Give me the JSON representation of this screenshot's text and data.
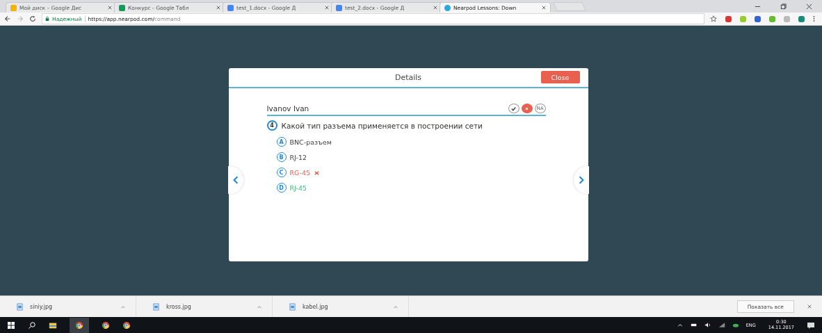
{
  "tabs": [
    {
      "title": "Мой диск – Google Дис",
      "selected": false
    },
    {
      "title": "Конкурс - Google Табл",
      "selected": false
    },
    {
      "title": "test_1.docx - Google Д",
      "selected": false
    },
    {
      "title": "test_2.docx - Google Д",
      "selected": false
    },
    {
      "title": "Nearpod Lessons: Down",
      "selected": true
    }
  ],
  "address": {
    "secure_label": "Надежный",
    "url_host": "https://app.nearpod.com/",
    "url_path": "command"
  },
  "modal": {
    "title": "Details",
    "close": "Close",
    "student": "Ivanov Ivan",
    "marks": [
      {
        "kind": "correct",
        "selected": false
      },
      {
        "kind": "wrong",
        "selected": true
      },
      {
        "kind": "na",
        "label": "NA",
        "selected": false
      }
    ],
    "question_number": "4",
    "question": "Какой тип разъема применяется в построении сети",
    "answers": [
      {
        "letter": "A",
        "text": "BNC-разъем",
        "kind": "normal"
      },
      {
        "letter": "B",
        "text": "RJ-12",
        "kind": "normal"
      },
      {
        "letter": "C",
        "text": "RG-45",
        "kind": "wrong"
      },
      {
        "letter": "D",
        "text": "RJ-45",
        "kind": "correct"
      }
    ]
  },
  "downloads": [
    {
      "name": "siniy.jpg"
    },
    {
      "name": "kross.jpg"
    },
    {
      "name": "kabel.jpg"
    }
  ],
  "downloads_show_all": "Показать все",
  "tray": {
    "lang": "ENG",
    "time": "0:30",
    "date": "14.11.2017"
  }
}
